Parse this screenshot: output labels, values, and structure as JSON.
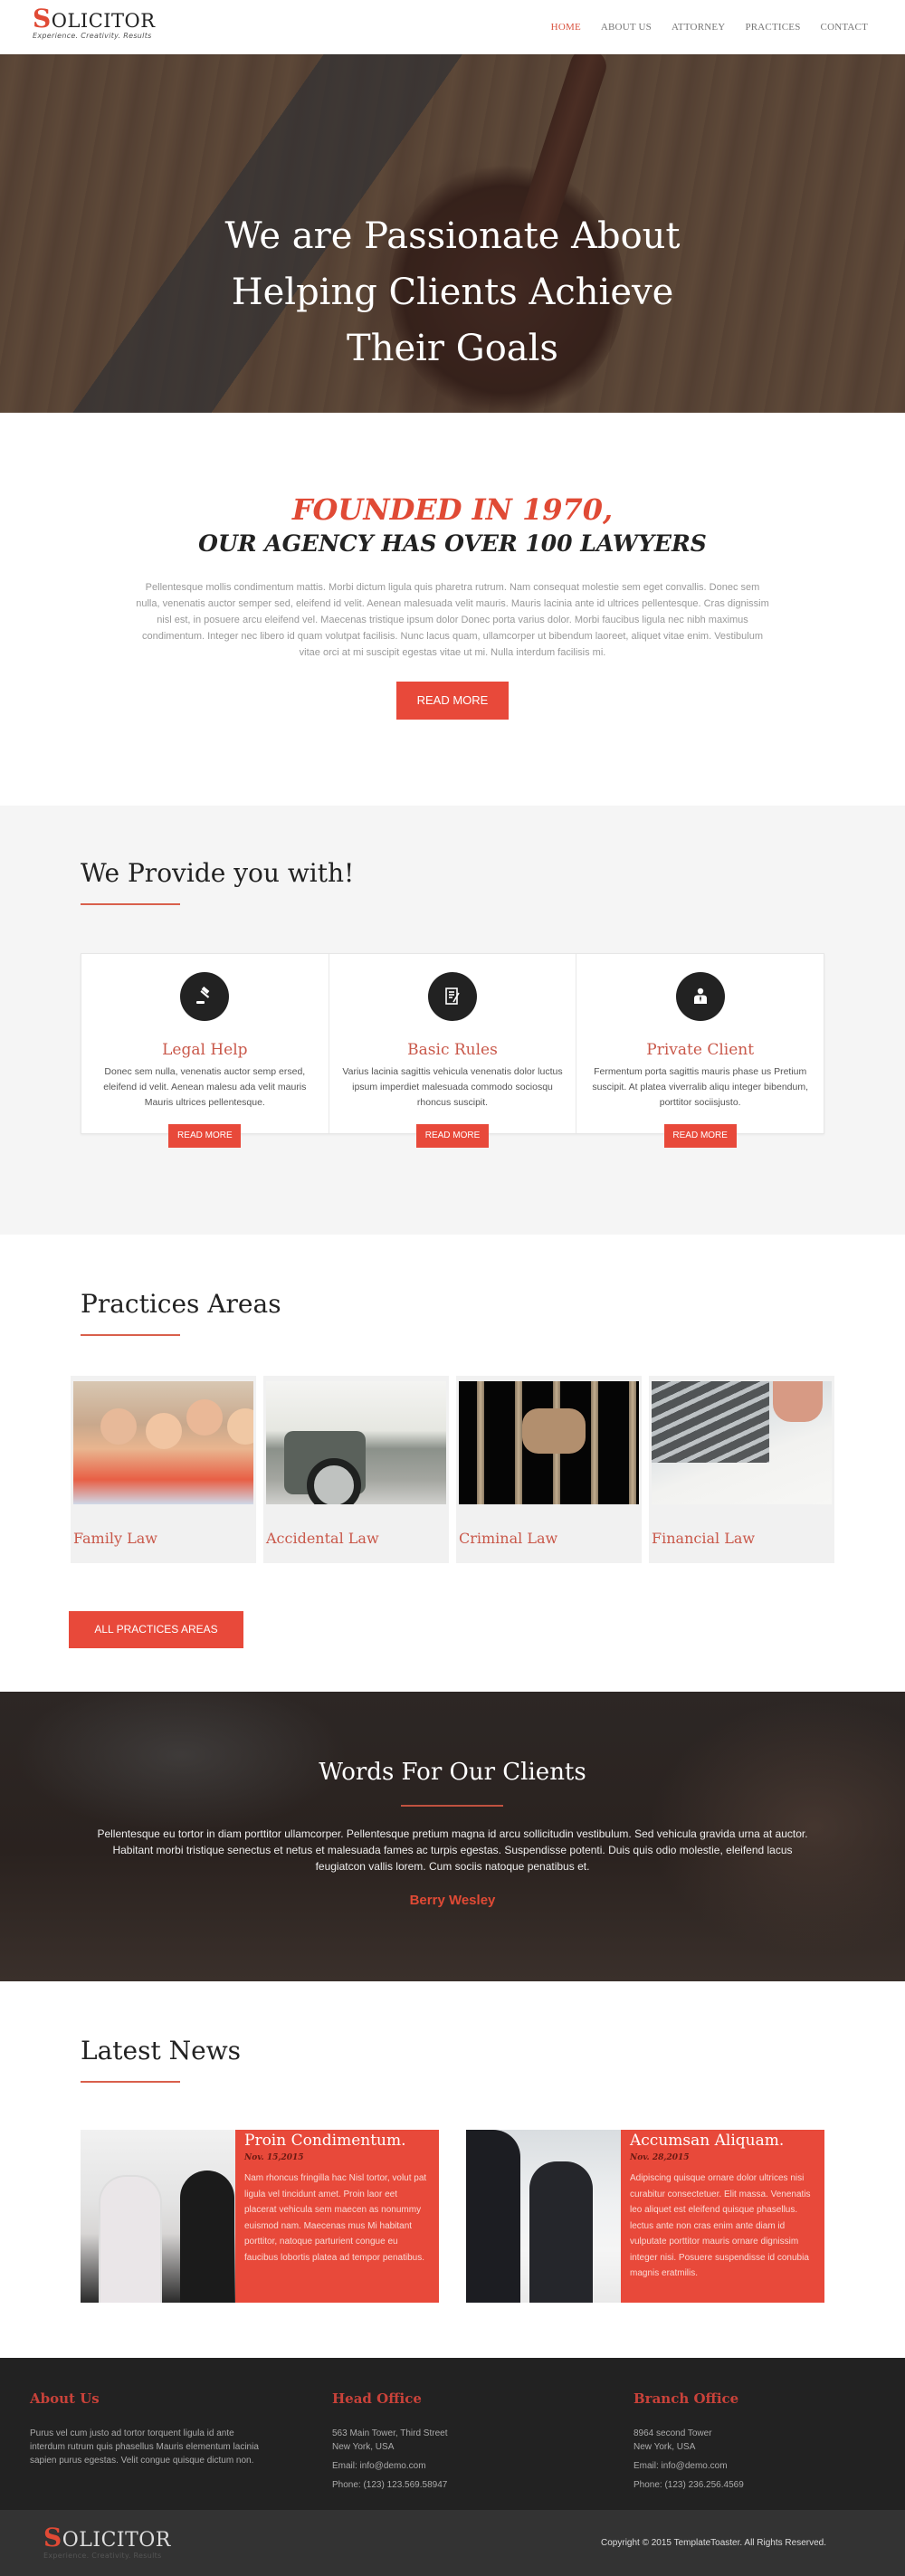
{
  "brand": {
    "first_letter": "S",
    "rest": "OLICITOR",
    "tagline": "Experience. Creativity. Results"
  },
  "colors": {
    "accent": "#e8493a",
    "heading_accent": "#c9584a",
    "dark": "#222222",
    "footer_bg": "#222222",
    "bottom_bar_bg": "#333333"
  },
  "nav": {
    "items": [
      {
        "label": "HOME",
        "active": true
      },
      {
        "label": "ABOUT US",
        "active": false
      },
      {
        "label": "ATTORNEY",
        "active": false
      },
      {
        "label": "PRACTICES",
        "active": false
      },
      {
        "label": "CONTACT",
        "active": false
      }
    ]
  },
  "hero": {
    "line1": "We are Passionate About",
    "line2": "Helping Clients Achieve",
    "line3": "Their Goals"
  },
  "founded": {
    "heading": "FOUNDED IN 1970,",
    "subheading": "OUR AGENCY HAS OVER 100 LAWYERS",
    "paragraph": "Pellentesque mollis condimentum mattis. Morbi dictum ligula quis pharetra rutrum. Nam consequat molestie sem eget convallis. Donec sem nulla, venenatis auctor semper sed, eleifend id velit. Aenean malesuada velit mauris. Mauris lacinia ante id ultrices pellentesque. Cras dignissim nisl est, in posuere arcu eleifend vel. Maecenas tristique ipsum dolor Donec porta varius dolor. Morbi faucibus ligula nec nibh maximus condimentum. Integer nec libero id quam volutpat facilisis. Nunc lacus quam, ullamcorper ut bibendum laoreet, aliquet vitae enim. Vestibulum vitae orci at mi suscipit egestas vitae ut mi. Nulla interdum facilisis mi.",
    "button": "READ MORE"
  },
  "provide": {
    "title": "We Provide you with!",
    "cards": [
      {
        "icon": "gavel-icon",
        "title": "Legal Help",
        "text": "Donec sem nulla, venenatis auctor semp ersed, eleifend id velit. Aenean malesu ada velit mauris Mauris ultrices pellentesque.",
        "button": "READ MORE"
      },
      {
        "icon": "document-signature-icon",
        "title": "Basic Rules",
        "text": "Varius lacinia sagittis vehicula venenatis dolor luctus ipsum imperdiet malesuada commodo sociosqu rhoncus suscipit.",
        "button": "READ MORE"
      },
      {
        "icon": "businessman-icon",
        "title": "Private Client",
        "text": "Fermentum porta sagittis mauris phase us Pretium suscipit. At platea viverralib aliqu integer bibendum, porttitor sociisjusto.",
        "button": "READ MORE"
      }
    ]
  },
  "practices": {
    "title": "Practices Areas",
    "items": [
      {
        "name": "Family Law",
        "image": "family-photo"
      },
      {
        "name": "Accidental Law",
        "image": "car-accident-photo"
      },
      {
        "name": "Criminal Law",
        "image": "prison-bars-photo"
      },
      {
        "name": "Financial Law",
        "image": "calculator-photo"
      }
    ],
    "button": "ALL PRACTICES AREAS"
  },
  "testimonial": {
    "title": "Words For Our Clients",
    "text": "Pellentesque eu tortor in diam porttitor ullamcorper. Pellentesque pretium magna id arcu sollicitudin vestibulum. Sed vehicula gravida urna at auctor.  Habitant morbi tristique senectus et netus et malesuada fames ac turpis egestas. Suspendisse potenti. Duis quis odio molestie, eleifend lacus feugiatcon vallis lorem. Cum sociis natoque penatibus et.",
    "author": "Berry Wesley"
  },
  "news": {
    "title": "Latest News",
    "items": [
      {
        "title": "Proin Condimentum.",
        "date": "Nov. 15,2015",
        "text": "Nam rhoncus fringilla hac Nisl tortor, volut pat ligula vel tincidunt amet. Proin laor eet placerat vehicula sem maecen as nonummy euismod nam. Maecenas mus Mi habitant porttitor, natoque parturient congue eu faucibus lobortis platea ad tempor penatibus."
      },
      {
        "title": "Accumsan Aliquam.",
        "date": "Nov. 28,2015",
        "text": "Adipiscing quisque ornare dolor ultrices nisi curabitur consectetuer. Elit massa. Venenatis leo aliquet est eleifend quisque phasellus. lectus ante non cras enim ante diam id vulputate porttitor mauris ornare dignissim integer nisi. Posuere suspendisse id conubia magnis eratmilis."
      }
    ]
  },
  "footer": {
    "about": {
      "heading": "About Us",
      "text": "Purus vel cum justo ad tortor torquent ligula id ante interdum rutrum quis phasellus Mauris elementum lacinia sapien purus egestas. Velit congue quisque dictum non."
    },
    "head_office": {
      "heading": "Head Office",
      "address1": "563 Main Tower, Third Street",
      "address2": "New York, USA",
      "email": "Email: info@demo.com",
      "phone": "Phone: (123) 123.569.58947"
    },
    "branch_office": {
      "heading": "Branch Office",
      "address1": "8964 second Tower",
      "address2": "New York, USA",
      "email": "Email: info@demo.com",
      "phone": "Phone: (123) 236.256.4569"
    },
    "copyright": "Copyright © 2015 TemplateToaster. All Rights Reserved."
  }
}
